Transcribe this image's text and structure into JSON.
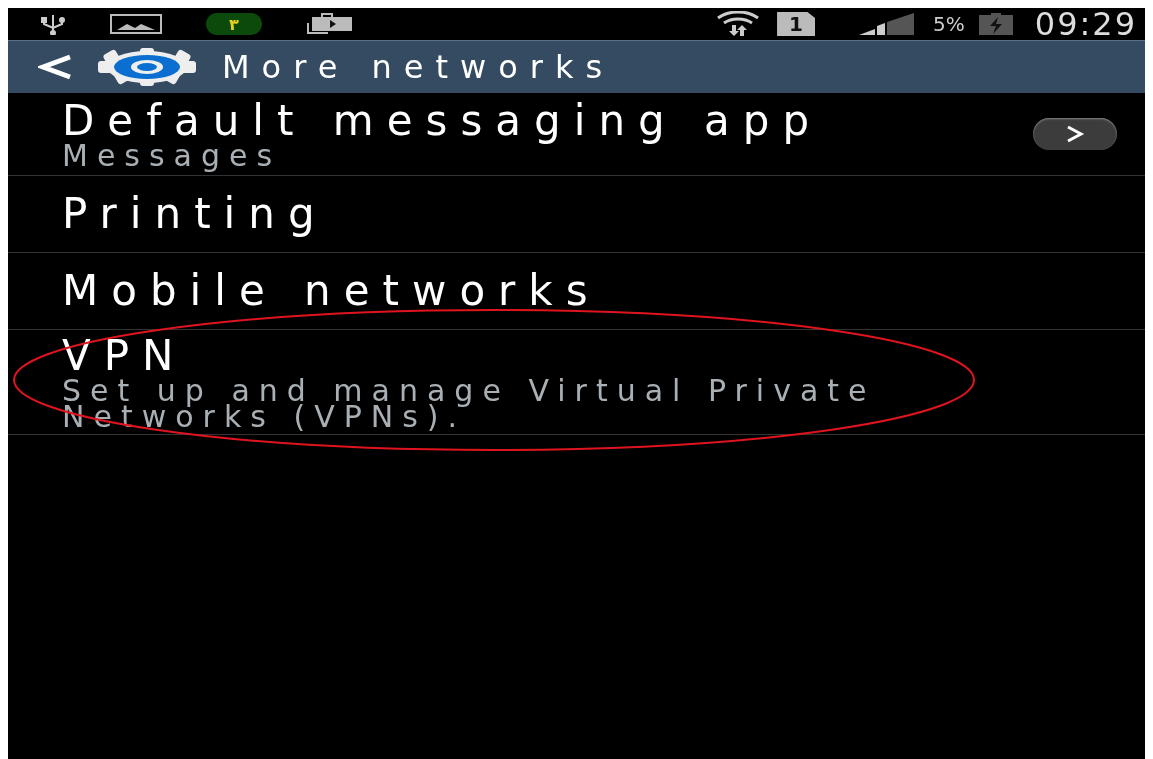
{
  "status_bar": {
    "notification_badge": "۳",
    "sim_slot": "1",
    "battery": "5%",
    "time": "09:29"
  },
  "action_bar": {
    "title": "More networks"
  },
  "items": [
    {
      "title": "Default messaging app",
      "subtitle": "Messages",
      "has_arrow": true,
      "highlighted": false
    },
    {
      "title": "Printing",
      "has_arrow": false,
      "highlighted": false
    },
    {
      "title": "Mobile networks",
      "has_arrow": false,
      "highlighted": false
    },
    {
      "title": "VPN",
      "subtitle": "Set up and manage Virtual Private Networks (VPNs).",
      "has_arrow": false,
      "highlighted": true
    }
  ]
}
